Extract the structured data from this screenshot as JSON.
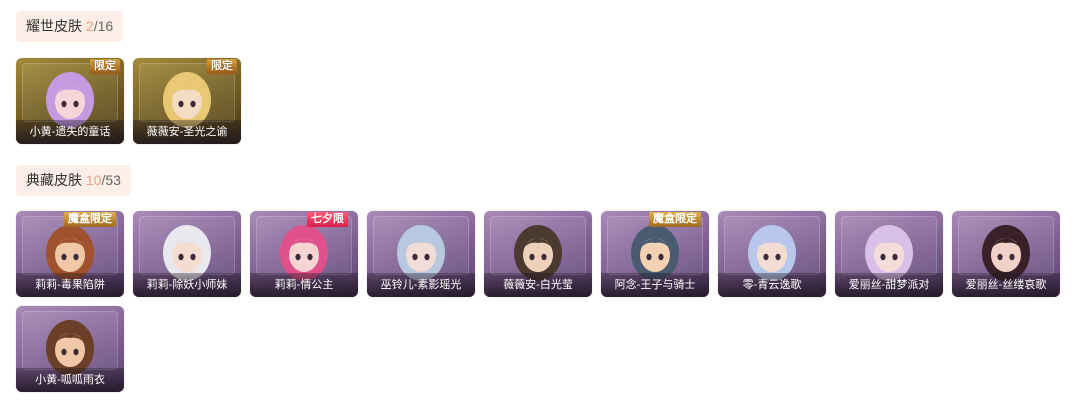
{
  "sections": [
    {
      "title": "耀世皮肤",
      "owned": "2",
      "total": "/16",
      "cards": [
        {
          "name": "小黄-遗失的童话",
          "badge": "限定",
          "style": "gold",
          "hair": "#c49be0",
          "skin": "#f6d4d8"
        },
        {
          "name": "薇薇安-圣光之谕",
          "badge": "限定",
          "style": "gold",
          "hair": "#e8c873",
          "skin": "#f3dcc4"
        }
      ]
    },
    {
      "title": "典藏皮肤",
      "owned": "10",
      "total": "/53",
      "cards": [
        {
          "name": "莉莉-毒果陷阱",
          "badge": "魔盒限定",
          "style": "purple",
          "hair": "#a0522d",
          "skin": "#f0c8a8"
        },
        {
          "name": "莉莉-除妖小师妹",
          "badge": "",
          "style": "purple",
          "hair": "#e8e8ee",
          "skin": "#f4dcd0"
        },
        {
          "name": "莉莉-情公主",
          "badge": "七夕限",
          "style": "purple",
          "hair": "#e0508a",
          "skin": "#f6d4d4"
        },
        {
          "name": "巫铃儿-素影瑶光",
          "badge": "",
          "style": "purple",
          "hair": "#b8c8e0",
          "skin": "#f2dcd6"
        },
        {
          "name": "薇薇安-白光莹",
          "badge": "",
          "style": "purple",
          "hair": "#4a3a30",
          "skin": "#efd0b8"
        },
        {
          "name": "阿念-王子与骑士",
          "badge": "魔盒限定",
          "style": "purple",
          "hair": "#4a5a70",
          "skin": "#f2d2b2"
        },
        {
          "name": "零-青云逸歌",
          "badge": "",
          "style": "purple",
          "hair": "#b8c8ec",
          "skin": "#f4dcd2"
        },
        {
          "name": "爱丽丝-甜梦派对",
          "badge": "",
          "style": "purple",
          "hair": "#d8c0e8",
          "skin": "#f6dcd8"
        },
        {
          "name": "爱丽丝-丝缕哀歌",
          "badge": "",
          "style": "purple",
          "hair": "#3a2028",
          "skin": "#f2d2c8"
        },
        {
          "name": "小黄-呱呱雨衣",
          "badge": "",
          "style": "purple",
          "hair": "#6a4028",
          "skin": "#f0c8a8"
        }
      ]
    }
  ]
}
